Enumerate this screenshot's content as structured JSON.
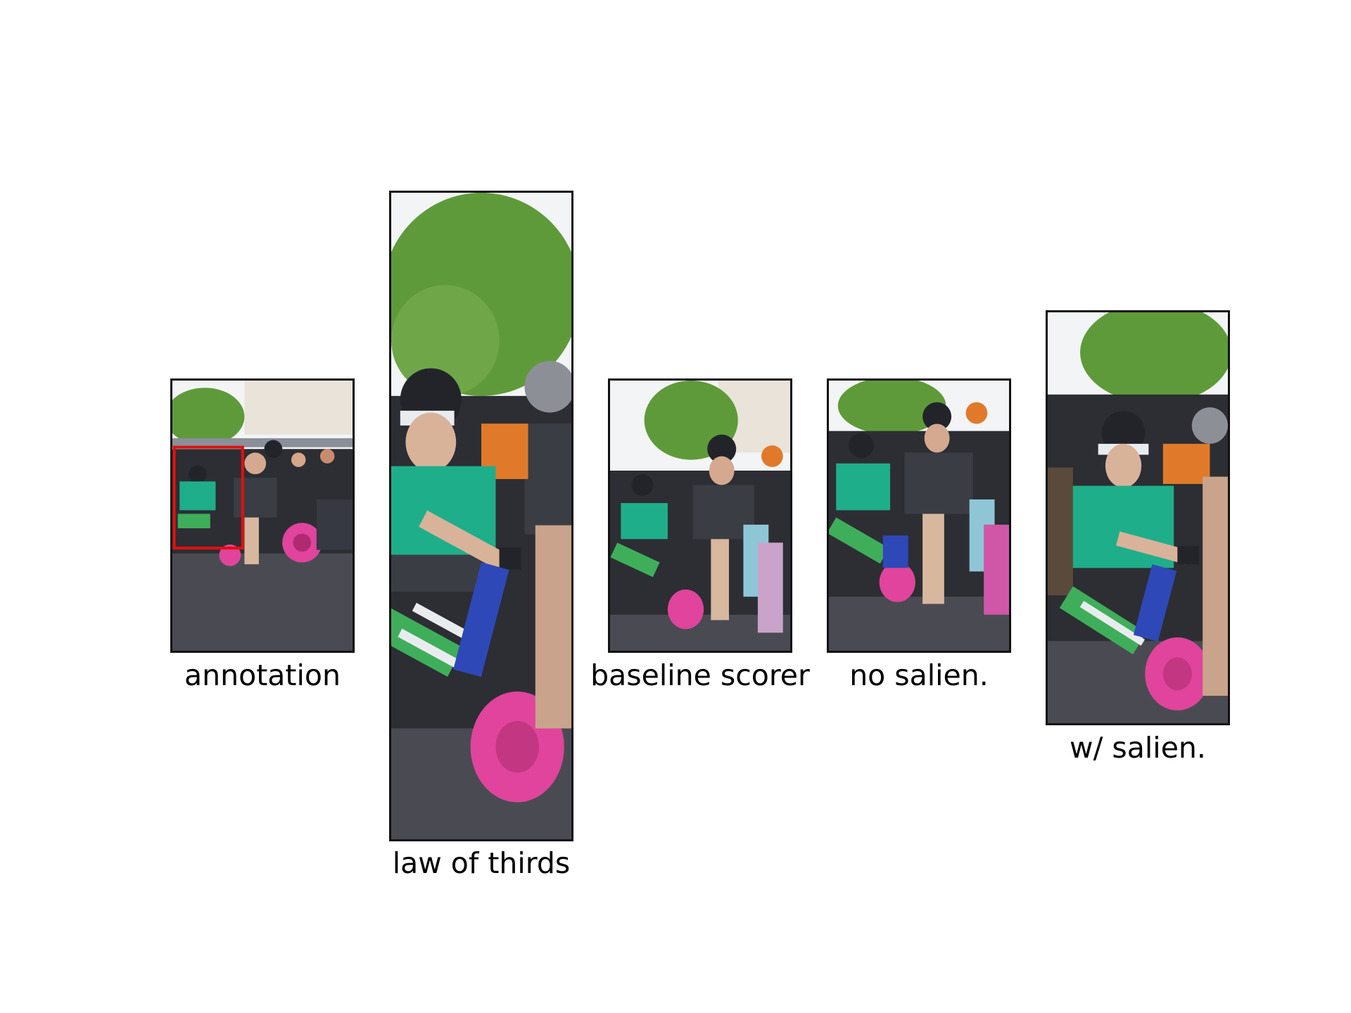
{
  "figure": {
    "panels": [
      {
        "id": "annotation",
        "caption": "annotation",
        "has_annotation_box": true,
        "annotation_box_color": "#e01010"
      },
      {
        "id": "law-of-thirds",
        "caption": "law of thirds",
        "has_annotation_box": false
      },
      {
        "id": "baseline-scorer",
        "caption": "baseline scorer",
        "has_annotation_box": false
      },
      {
        "id": "no-salien",
        "caption": "no salien.",
        "has_annotation_box": false
      },
      {
        "id": "w-salien",
        "caption": "w/ salien.",
        "has_annotation_box": false
      }
    ],
    "colors": {
      "frame": "#111111",
      "sky": "#f2f4f6",
      "tree": "#5f9a3a",
      "road": "#4a4b52",
      "shirt_teal": "#1fae8a",
      "shirt_dark": "#3a3d44",
      "wheel_pink": "#e0449c",
      "helmet": "#22242a",
      "stripes_green": "#3fae5a"
    }
  }
}
